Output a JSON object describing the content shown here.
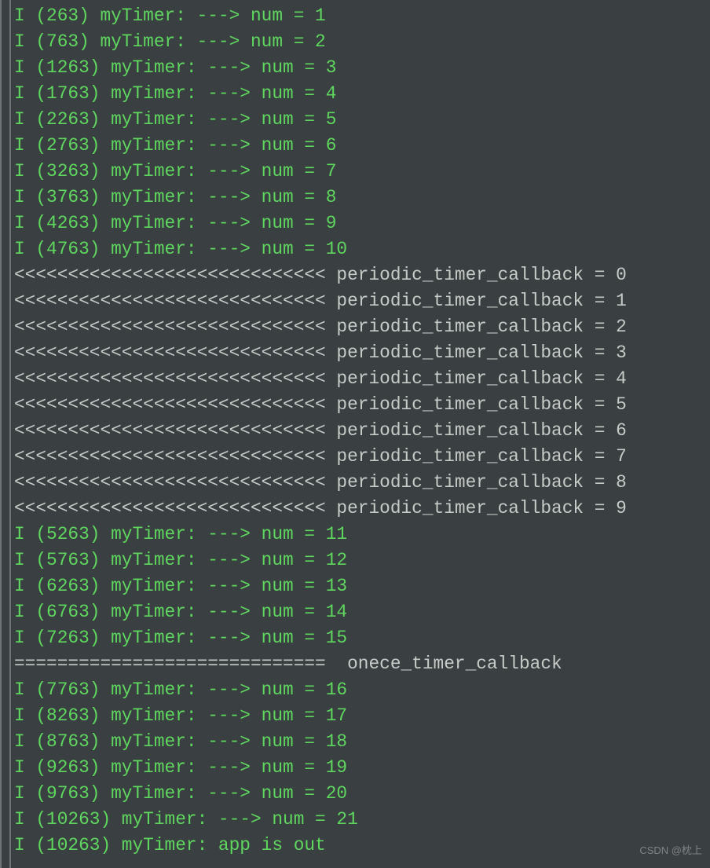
{
  "watermark": "CSDN @枕上",
  "lines": [
    {
      "cls": "green",
      "text": "I (263) myTimer: ---> num = 1"
    },
    {
      "cls": "green",
      "text": "I (763) myTimer: ---> num = 2"
    },
    {
      "cls": "green",
      "text": "I (1263) myTimer: ---> num = 3"
    },
    {
      "cls": "green",
      "text": "I (1763) myTimer: ---> num = 4"
    },
    {
      "cls": "green",
      "text": "I (2263) myTimer: ---> num = 5"
    },
    {
      "cls": "green",
      "text": "I (2763) myTimer: ---> num = 6"
    },
    {
      "cls": "green",
      "text": "I (3263) myTimer: ---> num = 7"
    },
    {
      "cls": "green",
      "text": "I (3763) myTimer: ---> num = 8"
    },
    {
      "cls": "green",
      "text": "I (4263) myTimer: ---> num = 9"
    },
    {
      "cls": "green",
      "text": "I (4763) myTimer: ---> num = 10"
    },
    {
      "cls": "gray",
      "text": "<<<<<<<<<<<<<<<<<<<<<<<<<<<<< periodic_timer_callback = 0"
    },
    {
      "cls": "gray",
      "text": "<<<<<<<<<<<<<<<<<<<<<<<<<<<<< periodic_timer_callback = 1"
    },
    {
      "cls": "gray",
      "text": "<<<<<<<<<<<<<<<<<<<<<<<<<<<<< periodic_timer_callback = 2"
    },
    {
      "cls": "gray",
      "text": "<<<<<<<<<<<<<<<<<<<<<<<<<<<<< periodic_timer_callback = 3"
    },
    {
      "cls": "gray",
      "text": "<<<<<<<<<<<<<<<<<<<<<<<<<<<<< periodic_timer_callback = 4"
    },
    {
      "cls": "gray",
      "text": "<<<<<<<<<<<<<<<<<<<<<<<<<<<<< periodic_timer_callback = 5"
    },
    {
      "cls": "gray",
      "text": "<<<<<<<<<<<<<<<<<<<<<<<<<<<<< periodic_timer_callback = 6"
    },
    {
      "cls": "gray",
      "text": "<<<<<<<<<<<<<<<<<<<<<<<<<<<<< periodic_timer_callback = 7"
    },
    {
      "cls": "gray",
      "text": "<<<<<<<<<<<<<<<<<<<<<<<<<<<<< periodic_timer_callback = 8"
    },
    {
      "cls": "gray",
      "text": "<<<<<<<<<<<<<<<<<<<<<<<<<<<<< periodic_timer_callback = 9"
    },
    {
      "cls": "green",
      "text": "I (5263) myTimer: ---> num = 11"
    },
    {
      "cls": "green",
      "text": "I (5763) myTimer: ---> num = 12"
    },
    {
      "cls": "green",
      "text": "I (6263) myTimer: ---> num = 13"
    },
    {
      "cls": "green",
      "text": "I (6763) myTimer: ---> num = 14"
    },
    {
      "cls": "green",
      "text": "I (7263) myTimer: ---> num = 15"
    },
    {
      "cls": "gray",
      "text": "=============================  onece_timer_callback"
    },
    {
      "cls": "green",
      "text": "I (7763) myTimer: ---> num = 16"
    },
    {
      "cls": "green",
      "text": "I (8263) myTimer: ---> num = 17"
    },
    {
      "cls": "green",
      "text": "I (8763) myTimer: ---> num = 18"
    },
    {
      "cls": "green",
      "text": "I (9263) myTimer: ---> num = 19"
    },
    {
      "cls": "green",
      "text": "I (9763) myTimer: ---> num = 20"
    },
    {
      "cls": "green",
      "text": "I (10263) myTimer: ---> num = 21"
    },
    {
      "cls": "green",
      "text": "I (10263) myTimer: app is out"
    }
  ]
}
